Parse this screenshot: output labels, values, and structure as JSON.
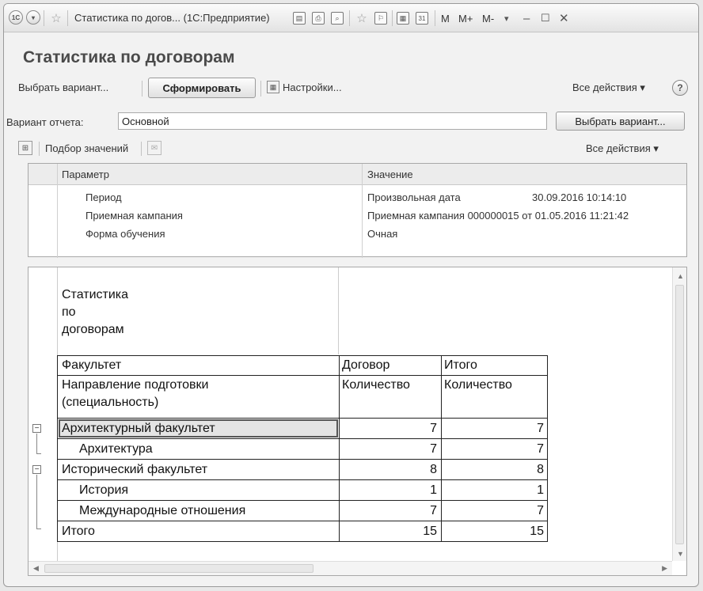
{
  "window": {
    "title": "Статистика по догов... (1С:Предприятие)",
    "app_icon": "1c-logo-icon",
    "titlebar_buttons": [
      "M",
      "M+",
      "M-"
    ]
  },
  "page": {
    "title": "Статистика по договорам"
  },
  "toolbar": {
    "choose_variant": "Выбрать вариант...",
    "generate": "Сформировать",
    "settings": "Настройки...",
    "all_actions": "Все действия ▾",
    "help": "?"
  },
  "variant": {
    "label": "Вариант отчета:",
    "value": "Основной",
    "choose_button": "Выбрать вариант..."
  },
  "params_toolbar": {
    "pick_values": "Подбор значений",
    "all_actions": "Все действия ▾"
  },
  "params": {
    "header": {
      "param": "Параметр",
      "value": "Значение"
    },
    "rows": [
      {
        "name": "Период",
        "value": "Произвольная дата",
        "extra": "30.09.2016 10:14:10"
      },
      {
        "name": "Приемная кампания",
        "value": "Приемная кампания 000000015 от 01.05.2016 11:21:42",
        "extra": ""
      },
      {
        "name": "Форма обучения",
        "value": "Очная",
        "extra": ""
      }
    ]
  },
  "report": {
    "title": "Статистика\nпо\nдоговорам",
    "title_lines": [
      "Статистика",
      "по",
      "договорам"
    ],
    "col_header_1": "Факультет",
    "col_header_2": "Договор",
    "col_header_3": "Итого",
    "subheader_1": "Направление подготовки",
    "subheader_1b": "(специальность)",
    "subheader_2": "Количество",
    "subheader_3": "Количество",
    "rows": [
      {
        "label": "Архитектурный факультет",
        "v1": "7",
        "v2": "7",
        "level": 0
      },
      {
        "label": "Архитектура",
        "v1": "7",
        "v2": "7",
        "level": 1
      },
      {
        "label": "Исторический факультет",
        "v1": "8",
        "v2": "8",
        "level": 0
      },
      {
        "label": "История",
        "v1": "1",
        "v2": "1",
        "level": 1
      },
      {
        "label": "Международные отношения",
        "v1": "7",
        "v2": "7",
        "level": 1
      },
      {
        "label": "Итого",
        "v1": "15",
        "v2": "15",
        "level": 0
      }
    ]
  }
}
